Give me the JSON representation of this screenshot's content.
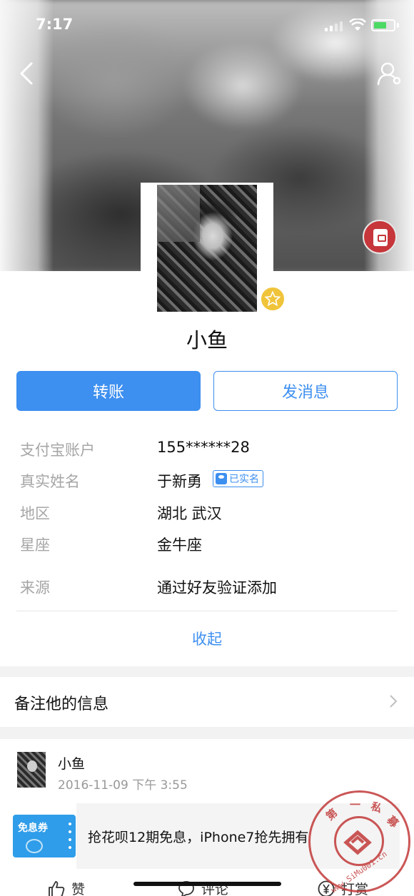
{
  "status_bar": {
    "time": "7:17"
  },
  "profile": {
    "name": "小鱼"
  },
  "buttons": {
    "transfer": "转账",
    "message": "发消息"
  },
  "info": {
    "rows": [
      {
        "label": "支付宝账户",
        "value": "155******28"
      },
      {
        "label": "真实姓名",
        "value": "于新勇",
        "badge": "已实名"
      },
      {
        "label": "地区",
        "value": "湖北 武汉"
      },
      {
        "label": "星座",
        "value": "金牛座"
      },
      {
        "label": "来源",
        "value": "通过好友验证添加"
      }
    ],
    "collapse_label": "收起"
  },
  "remark": {
    "label": "备注他的信息"
  },
  "feed": {
    "name": "小鱼",
    "time": "2016-11-09 下午 3:55",
    "coupon_label": "免息券",
    "promo_text": "抢花呗12期免息，iPhone7抢先拥有",
    "actions": {
      "like": "赞",
      "comment": "评论",
      "reward": "打赏"
    }
  },
  "watermark": {
    "chars": [
      "第",
      "一",
      "私",
      "募"
    ],
    "url": "www.SiMu001.cn"
  },
  "colors": {
    "accent": "#3d8ff0",
    "red_packet": "#c6363a",
    "battery": "#4cd964",
    "star": "#f0c43a"
  }
}
